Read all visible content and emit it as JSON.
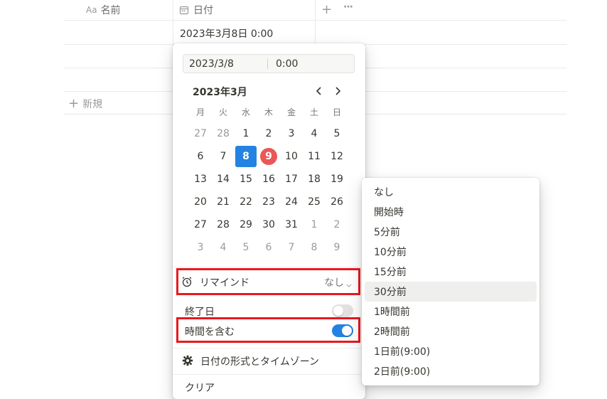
{
  "table": {
    "name_col": {
      "icon_text": "Aa",
      "label": "名前"
    },
    "date_col": {
      "label": "日付"
    },
    "add_col_symbol": "+",
    "more_symbol": "···",
    "row1_date": "2023年3月8日 0:00",
    "new_row_label": "新規"
  },
  "date_input": {
    "date": "2023/3/8",
    "time": "0:00"
  },
  "calendar": {
    "month_label": "2023年3月",
    "weekdays": [
      "月",
      "火",
      "水",
      "木",
      "金",
      "土",
      "日"
    ],
    "weeks": [
      [
        "27",
        "28",
        "1",
        "2",
        "3",
        "4",
        "5"
      ],
      [
        "6",
        "7",
        "8",
        "9",
        "10",
        "11",
        "12"
      ],
      [
        "13",
        "14",
        "15",
        "16",
        "17",
        "18",
        "19"
      ],
      [
        "20",
        "21",
        "22",
        "23",
        "24",
        "25",
        "26"
      ],
      [
        "27",
        "28",
        "29",
        "30",
        "31",
        "1",
        "2"
      ],
      [
        "3",
        "4",
        "5",
        "6",
        "7",
        "8",
        "9"
      ]
    ],
    "selected_day": "8",
    "today_day": "9"
  },
  "reminder": {
    "label": "リマインド",
    "value": "なし"
  },
  "end_date": {
    "label": "終了日",
    "enabled": false
  },
  "include_time": {
    "label": "時間を含む",
    "enabled": true
  },
  "format_timezone": {
    "label": "日付の形式とタイムゾーン"
  },
  "clear": {
    "label": "クリア"
  },
  "reminder_menu": {
    "items": [
      "なし",
      "開始時",
      "5分前",
      "10分前",
      "15分前",
      "30分前",
      "1時間前",
      "2時間前",
      "1日前(9:00)",
      "2日前(9:00)"
    ],
    "highlighted": "30分前"
  },
  "colors": {
    "accent": "#2383e2",
    "today": "#eb5757",
    "annotation": "#e8191f"
  }
}
